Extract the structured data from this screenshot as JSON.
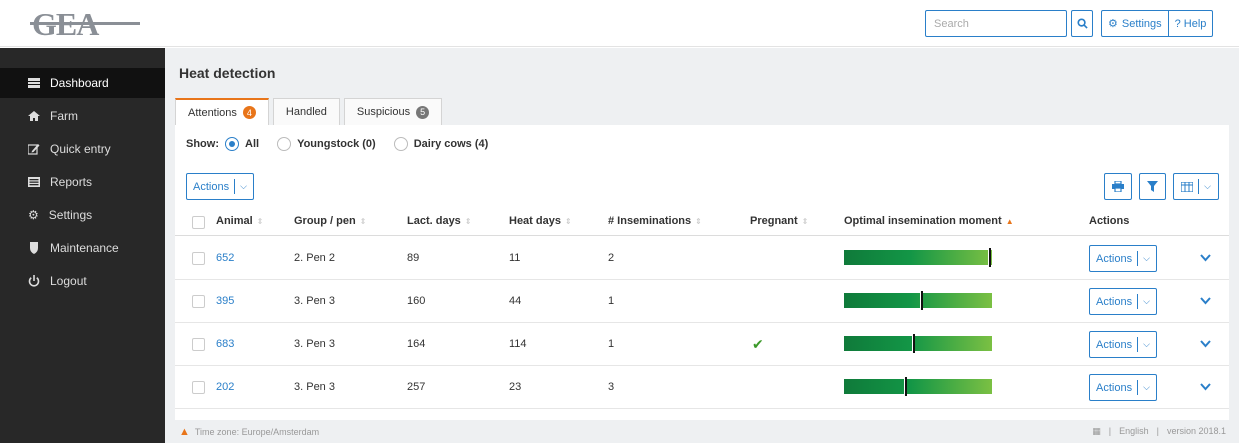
{
  "brand": {
    "logo_text": "GEA"
  },
  "header": {
    "search_placeholder": "Search",
    "settings_label": "Settings",
    "help_label": "? Help"
  },
  "sidebar": {
    "items": [
      {
        "label": "Dashboard",
        "icon": "dashboard-icon",
        "active": true
      },
      {
        "label": "Farm",
        "icon": "home-icon"
      },
      {
        "label": "Quick entry",
        "icon": "edit-icon"
      },
      {
        "label": "Reports",
        "icon": "reports-icon"
      },
      {
        "label": "Settings",
        "icon": "gears-icon"
      },
      {
        "label": "Maintenance",
        "icon": "shield-icon"
      },
      {
        "label": "Logout",
        "icon": "power-icon"
      }
    ]
  },
  "main": {
    "title": "Heat detection",
    "tabs": [
      {
        "label": "Attentions",
        "badge": "4"
      },
      {
        "label": "Handled"
      },
      {
        "label": "Suspicious",
        "badge": "5"
      }
    ],
    "show": {
      "label": "Show:",
      "options": [
        "All",
        "Youngstock (0)",
        "Dairy cows (4)"
      ],
      "selected": "All"
    },
    "actions_label": "Actions",
    "columns": [
      "Animal",
      "Group / pen",
      "Lact. days",
      "Heat days",
      "# Inseminations",
      "Pregnant",
      "Optimal insemination moment",
      "Actions"
    ],
    "rows": [
      {
        "animal": "652",
        "group": "2. Pen 2",
        "lact": "89",
        "heat": "11",
        "insem": "2",
        "pregnant": false,
        "moment": 0.99,
        "actions": "Actions"
      },
      {
        "animal": "395",
        "group": "3. Pen 3",
        "lact": "160",
        "heat": "44",
        "insem": "1",
        "pregnant": false,
        "moment": 0.53,
        "actions": "Actions"
      },
      {
        "animal": "683",
        "group": "3. Pen 3",
        "lact": "164",
        "heat": "114",
        "insem": "1",
        "pregnant": true,
        "moment": 0.47,
        "actions": "Actions"
      },
      {
        "animal": "202",
        "group": "3. Pen 3",
        "lact": "257",
        "heat": "23",
        "insem": "3",
        "pregnant": false,
        "moment": 0.42,
        "actions": "Actions"
      }
    ]
  },
  "footer": {
    "timezone": "Time zone: Europe/Amsterdam",
    "language": "English",
    "version": "version 2018.1"
  },
  "colors": {
    "accent": "#2a7fc9",
    "orange": "#e8751a",
    "sidebar": "#282828"
  }
}
